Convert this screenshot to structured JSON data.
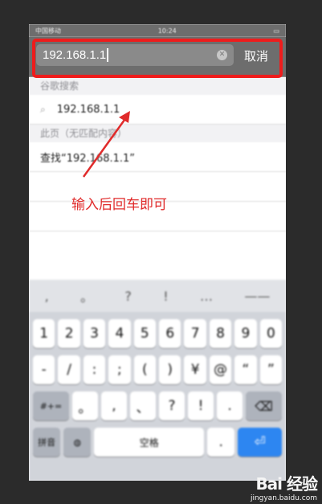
{
  "statusbar": {
    "carrier": "中国移动",
    "time": "10:24"
  },
  "urlbar": {
    "value": "192.168.1.1",
    "cancel_label": "取消"
  },
  "suggestions": {
    "google_header": "谷歌搜索",
    "google_item": "192.168.1.1",
    "page_header": "此页（无匹配内容）",
    "find_item": "查找“192.168.1.1”"
  },
  "annotation": "输入后回车即可",
  "keyboard": {
    "predict": [
      ",",
      "。",
      "?",
      "!",
      "…",
      "——"
    ],
    "row_numbers": [
      "1",
      "2",
      "3",
      "4",
      "5",
      "6",
      "7",
      "8",
      "9",
      "0"
    ],
    "row_symbols": [
      "-",
      "/",
      ":",
      ";",
      "(",
      ")",
      "¥",
      "@",
      "“",
      "”"
    ],
    "more_label": "#+=",
    "row_punct": [
      "。",
      ",",
      "、",
      "?",
      "!",
      "."
    ],
    "pinyin_label": "拼音",
    "space_label": "空格",
    "dot_label": "."
  },
  "watermark": {
    "brand": "Bai 经验",
    "url": "jingyan.baidu.com"
  },
  "colors": {
    "annotation_red": "#ee1c1c",
    "keyboard_bg": "#d1d4da",
    "return_blue": "#2d86f1"
  }
}
